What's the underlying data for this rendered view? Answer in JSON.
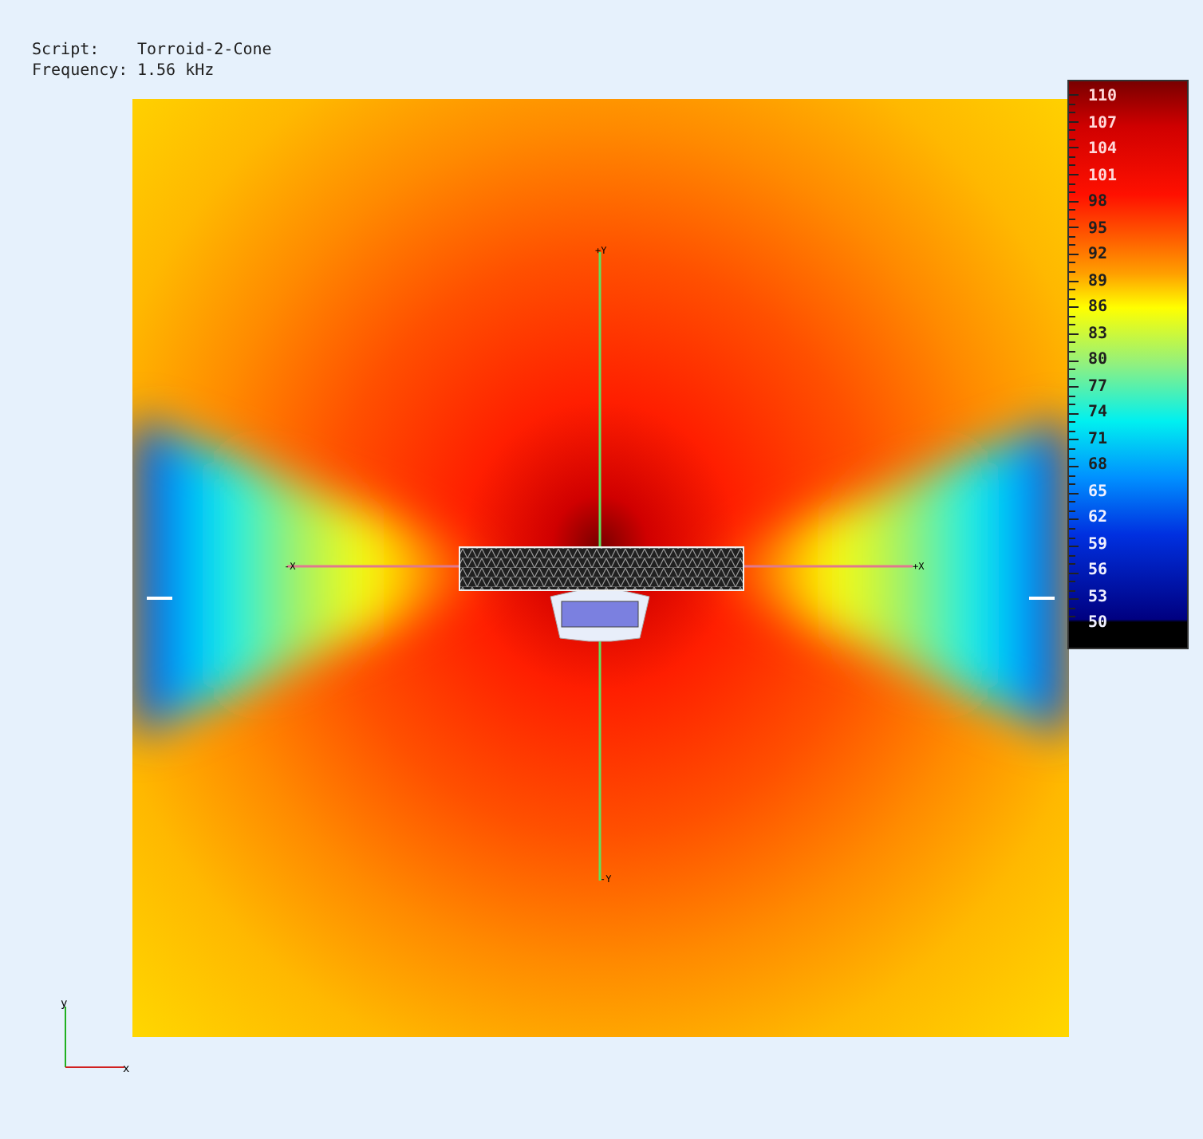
{
  "script": {
    "label": "Script:",
    "value": "Torroid-2-Cone"
  },
  "frequency": {
    "label": "Frequency:",
    "value": "1.56 kHz"
  },
  "plot": {
    "axis_labels": {
      "top": "+Y",
      "left": "-X",
      "right": "+X",
      "bottom": "-Y"
    }
  },
  "colorbar": {
    "labels": [
      "110",
      "107",
      "104",
      "101",
      "98",
      "95",
      "92",
      "89",
      "86",
      "83",
      "80",
      "77",
      "74",
      "71",
      "68",
      "65",
      "62",
      "59",
      "56",
      "53",
      "50"
    ]
  },
  "axes_triad": {
    "y": "y",
    "x": "x"
  }
}
